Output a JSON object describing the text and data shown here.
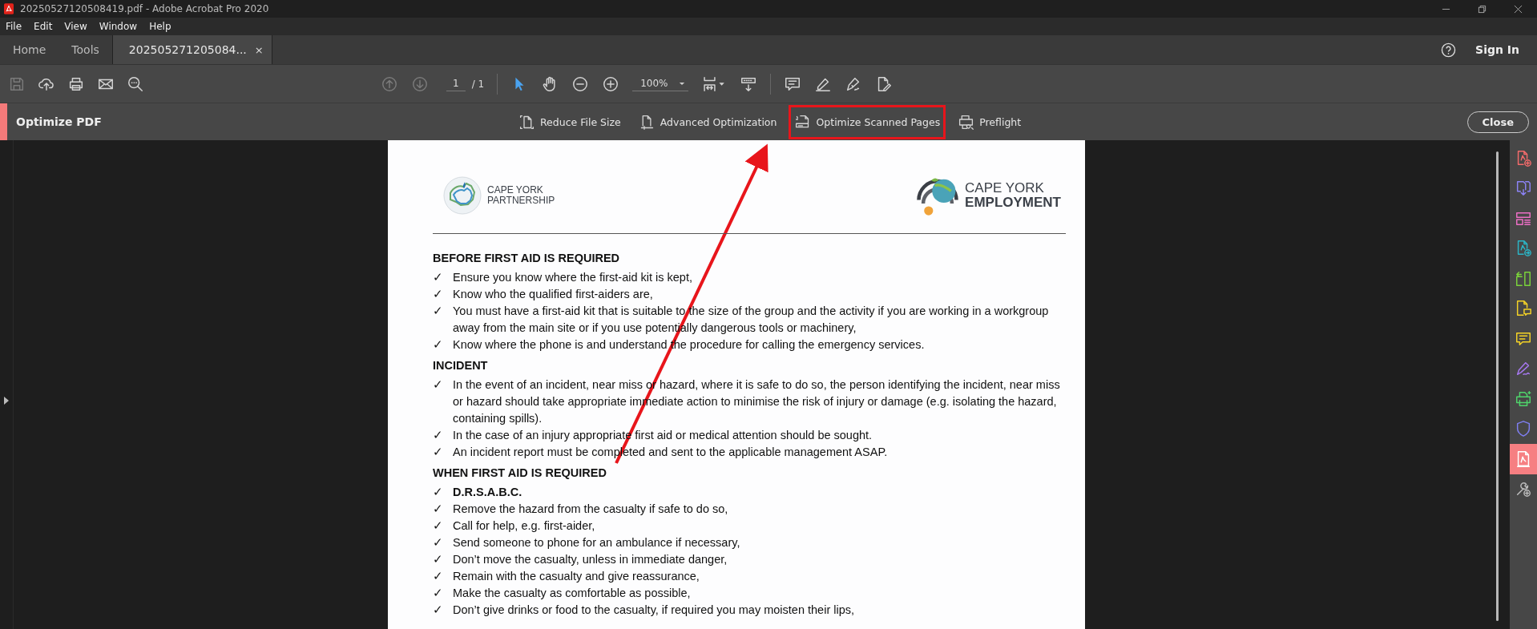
{
  "window": {
    "title": "20250527120508419.pdf - Adobe Acrobat Pro 2020"
  },
  "menu": [
    "File",
    "Edit",
    "View",
    "Window",
    "Help"
  ],
  "tabs": [
    {
      "label": "Home",
      "selected": false,
      "closable": false
    },
    {
      "label": "Tools",
      "selected": false,
      "closable": false
    },
    {
      "label": "202505271205084...",
      "selected": true,
      "closable": true,
      "close": "×"
    }
  ],
  "header_actions": {
    "sign_in": "Sign In"
  },
  "toolbar": {
    "left": [
      {
        "kind": "save",
        "disabled": true
      },
      {
        "kind": "upload",
        "disabled": false
      },
      {
        "kind": "print",
        "disabled": false
      },
      {
        "kind": "mail",
        "disabled": false
      },
      {
        "kind": "find",
        "disabled": false
      }
    ],
    "nav": [
      {
        "kind": "prev",
        "disabled": true
      },
      {
        "kind": "next",
        "disabled": true
      }
    ],
    "page_number": "1",
    "page_total": "/ 1",
    "tools": [
      {
        "kind": "select",
        "selected": true
      },
      {
        "kind": "hand",
        "selected": false
      },
      {
        "kind": "zoom-out",
        "selected": false
      },
      {
        "kind": "zoom-in",
        "selected": false
      }
    ],
    "zoom": "100%",
    "right": [
      {
        "kind": "comment"
      },
      {
        "kind": "highlight"
      },
      {
        "kind": "sign"
      },
      {
        "kind": "edit"
      }
    ]
  },
  "optimize_bar": {
    "title": "Optimize PDF",
    "close": "Close",
    "tools": [
      {
        "kind": "reduce",
        "label": "Reduce File Size",
        "highlighted": false
      },
      {
        "kind": "advanced",
        "label": "Advanced Optimization",
        "highlighted": false
      },
      {
        "kind": "scanned",
        "label": "Optimize Scanned Pages",
        "highlighted": true
      },
      {
        "kind": "preflight",
        "label": "Preflight",
        "highlighted": false
      }
    ]
  },
  "document": {
    "logos": [
      {
        "kind": "partnership",
        "lines": [
          "CAPE YORK",
          "PARTNERSHIP"
        ]
      },
      {
        "kind": "employment",
        "lines": [
          "CAPE YORK",
          "EMPLOYMENT"
        ]
      }
    ],
    "sections": [
      {
        "heading": "BEFORE FIRST AID IS REQUIRED",
        "items": [
          {
            "text": "Ensure you know where the first-aid kit is kept,",
            "bold": false
          },
          {
            "text": "Know who the qualified first-aiders are,",
            "bold": false
          },
          {
            "text": "You must have a first-aid kit that is suitable to the size of the group and the activity if you are working in a workgroup away from the main site or if you use potentially dangerous tools or machinery,",
            "bold": false
          },
          {
            "text": "Know where the phone is and understand the procedure for calling the emergency services.",
            "bold": false
          }
        ]
      },
      {
        "heading": "INCIDENT",
        "items": [
          {
            "text": "In the event of an incident, near miss or hazard, where it is safe to do so, the person identifying the incident, near miss or hazard should take appropriate immediate action to minimise the risk of injury or damage (e.g. isolating the hazard, containing spills).",
            "bold": false
          },
          {
            "text": "In the case of an injury appropriate first aid or medical attention should be sought.",
            "bold": false
          },
          {
            "text": "An incident report must be completed and sent to the applicable management ASAP.",
            "bold": false
          }
        ]
      },
      {
        "heading": "WHEN FIRST AID IS REQUIRED",
        "items": [
          {
            "text": "D.R.S.A.B.C.",
            "bold": true
          },
          {
            "text": "Remove the hazard from the casualty if safe to do so,",
            "bold": false
          },
          {
            "text": "Call for help, e.g. first-aider,",
            "bold": false
          },
          {
            "text": "Send someone to phone for an ambulance if necessary,",
            "bold": false
          },
          {
            "text": "Don’t move the casualty, unless in immediate danger,",
            "bold": false
          },
          {
            "text": "Remain with the casualty and give reassurance,",
            "bold": false
          },
          {
            "text": "Make the casualty as comfortable as possible,",
            "bold": false
          },
          {
            "text": "Don’t give drinks or food to the casualty, if required you may moisten their lips,",
            "bold": false
          }
        ]
      }
    ],
    "check": "✓"
  },
  "sidebar": [
    {
      "kind": "pdf-add",
      "color": "#f46b6b",
      "selected": false
    },
    {
      "kind": "pdf-export",
      "color": "#8c83f5",
      "selected": false
    },
    {
      "kind": "organize",
      "color": "#ec6fc5",
      "selected": false
    },
    {
      "kind": "pdf-send",
      "color": "#2bb5c6",
      "selected": false
    },
    {
      "kind": "pages",
      "color": "#7bd33b",
      "selected": false
    },
    {
      "kind": "doc-comment",
      "color": "#f5d326",
      "selected": false
    },
    {
      "kind": "comment",
      "color": "#f5d326",
      "selected": false
    },
    {
      "kind": "pen",
      "color": "#a678ef",
      "selected": false
    },
    {
      "kind": "printer",
      "color": "#4fd46b",
      "selected": false
    },
    {
      "kind": "shield",
      "color": "#7f7ff2",
      "selected": false
    },
    {
      "kind": "pdf",
      "color": "#ffffff",
      "selected": true
    },
    {
      "kind": "tools",
      "color": "#bdbdbd",
      "selected": false
    }
  ]
}
